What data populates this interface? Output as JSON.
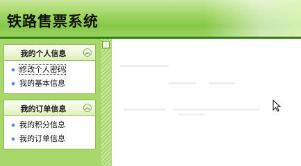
{
  "header": {
    "title": "铁路售票系统"
  },
  "sidebar": {
    "panels": [
      {
        "title": "我的个人信息",
        "toggle_icon": "double-chevron-up-icon",
        "items": [
          {
            "label": "修改个人密码",
            "focused": true
          },
          {
            "label": "我的基本信息"
          }
        ]
      },
      {
        "title": "我的订单信息",
        "toggle_icon": "double-chevron-up-icon",
        "items": [
          {
            "label": "我的积分信息"
          },
          {
            "label": "我的订单信息"
          }
        ]
      }
    ]
  },
  "colors": {
    "header_accent": "#86c748",
    "header_border": "#2e7d12",
    "sidebar_bg": "#a8d86c",
    "bullet": "#5d88c8"
  }
}
